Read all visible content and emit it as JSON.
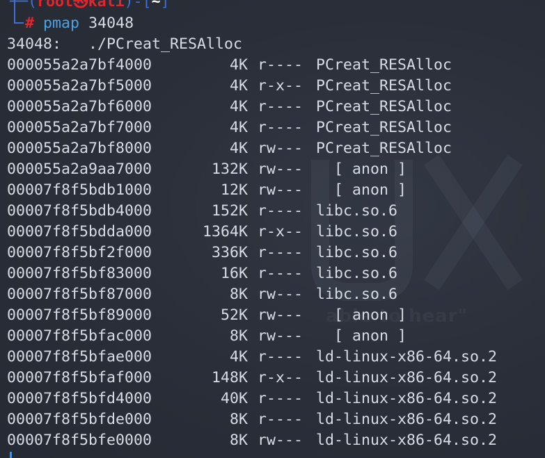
{
  "prompt": {
    "user": "root㉿kali",
    "dir": "~",
    "symbol": "#",
    "command": "pmap",
    "argument": "34048"
  },
  "header": "34048:   ./PCreat_RESAlloc",
  "watermark": "able to hear\"",
  "rows": [
    {
      "addr": "000055a2a7bf4000",
      "kb": "4K",
      "perm": "r----",
      "map": "PCreat_RESAlloc"
    },
    {
      "addr": "000055a2a7bf5000",
      "kb": "4K",
      "perm": "r-x--",
      "map": "PCreat_RESAlloc"
    },
    {
      "addr": "000055a2a7bf6000",
      "kb": "4K",
      "perm": "r----",
      "map": "PCreat_RESAlloc"
    },
    {
      "addr": "000055a2a7bf7000",
      "kb": "4K",
      "perm": "r----",
      "map": "PCreat_RESAlloc"
    },
    {
      "addr": "000055a2a7bf8000",
      "kb": "4K",
      "perm": "rw---",
      "map": "PCreat_RESAlloc"
    },
    {
      "addr": "000055a2a9aa7000",
      "kb": "132K",
      "perm": "rw---",
      "map": "  [ anon ]"
    },
    {
      "addr": "00007f8f5bdb1000",
      "kb": "12K",
      "perm": "rw---",
      "map": "  [ anon ]"
    },
    {
      "addr": "00007f8f5bdb4000",
      "kb": "152K",
      "perm": "r----",
      "map": "libc.so.6"
    },
    {
      "addr": "00007f8f5bdda000",
      "kb": "1364K",
      "perm": "r-x--",
      "map": "libc.so.6"
    },
    {
      "addr": "00007f8f5bf2f000",
      "kb": "336K",
      "perm": "r----",
      "map": "libc.so.6"
    },
    {
      "addr": "00007f8f5bf83000",
      "kb": "16K",
      "perm": "r----",
      "map": "libc.so.6"
    },
    {
      "addr": "00007f8f5bf87000",
      "kb": "8K",
      "perm": "rw---",
      "map": "libc.so.6"
    },
    {
      "addr": "00007f8f5bf89000",
      "kb": "52K",
      "perm": "rw---",
      "map": "  [ anon ]"
    },
    {
      "addr": "00007f8f5bfac000",
      "kb": "8K",
      "perm": "rw---",
      "map": "  [ anon ]"
    },
    {
      "addr": "00007f8f5bfae000",
      "kb": "4K",
      "perm": "r----",
      "map": "ld-linux-x86-64.so.2"
    },
    {
      "addr": "00007f8f5bfaf000",
      "kb": "148K",
      "perm": "r-x--",
      "map": "ld-linux-x86-64.so.2"
    },
    {
      "addr": "00007f8f5bfd4000",
      "kb": "40K",
      "perm": "r----",
      "map": "ld-linux-x86-64.so.2"
    },
    {
      "addr": "00007f8f5bfde000",
      "kb": "8K",
      "perm": "r----",
      "map": "ld-linux-x86-64.so.2"
    },
    {
      "addr": "00007f8f5bfe0000",
      "kb": "8K",
      "perm": "rw---",
      "map": "ld-linux-x86-64.so.2"
    }
  ]
}
